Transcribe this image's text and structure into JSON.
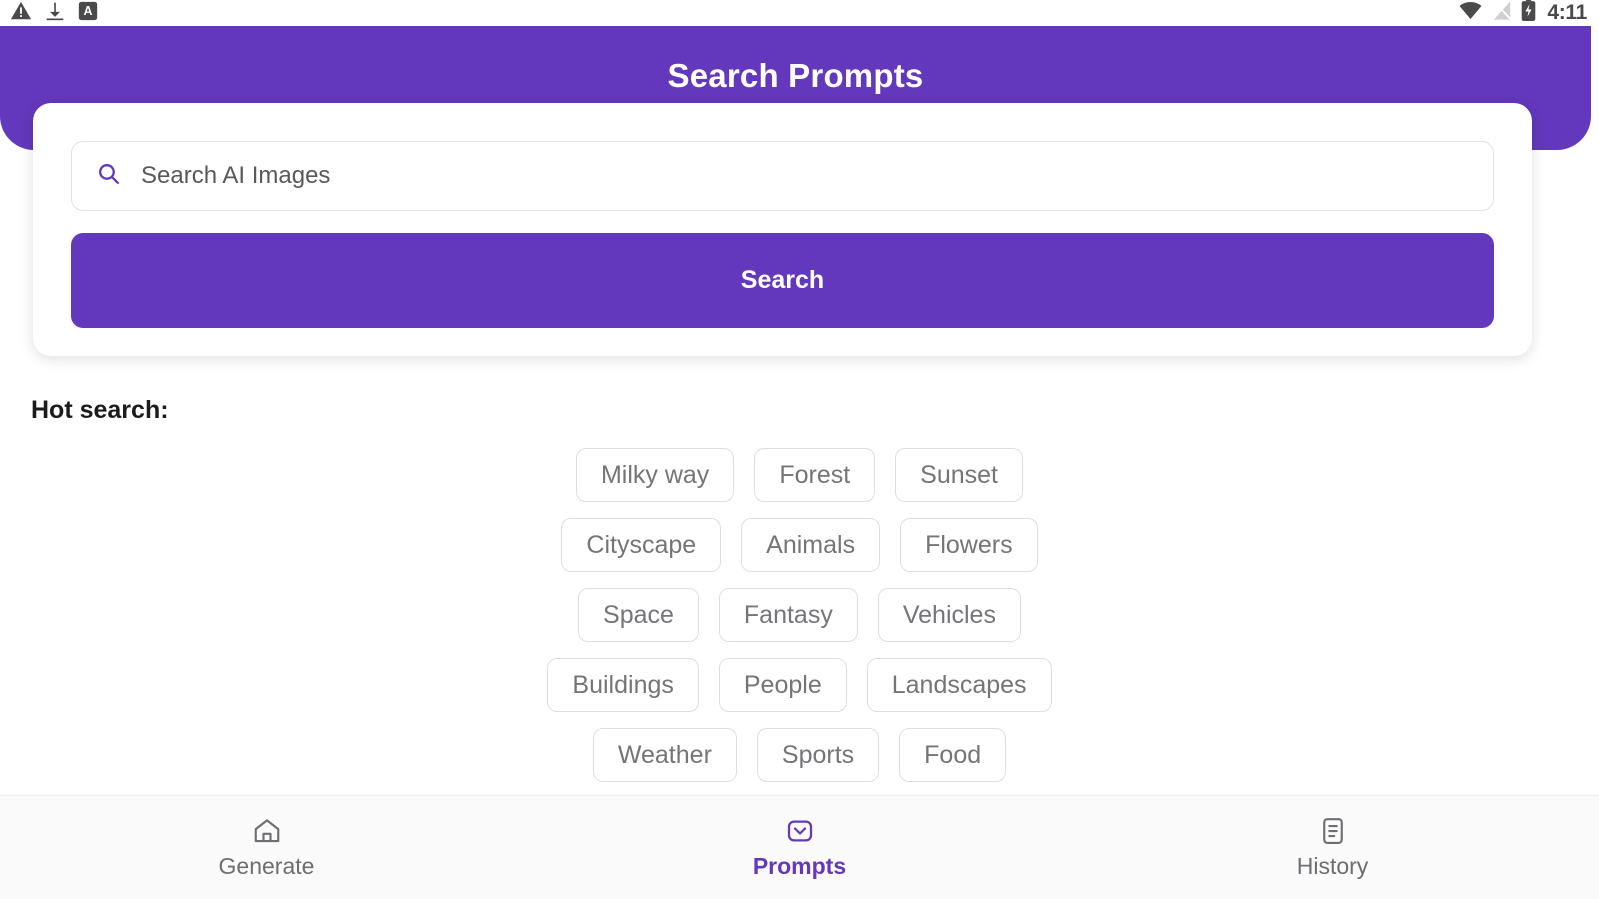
{
  "statusbar": {
    "time": "4:11",
    "left_icons": [
      "warning-triangle-icon",
      "download-icon",
      "screenshot-a-icon"
    ],
    "right_icons": [
      "wifi-icon",
      "no-sim-icon",
      "battery-charging-icon"
    ]
  },
  "header": {
    "title": "Search Prompts",
    "background_color": "#6338bc"
  },
  "search": {
    "placeholder": "Search AI Images",
    "value": "",
    "icon": "search-icon",
    "button_label": "Search",
    "button_color": "#6338bc"
  },
  "hot_search": {
    "label": "Hot search:",
    "rows": [
      [
        "Milky way",
        "Forest",
        "Sunset"
      ],
      [
        "Cityscape",
        "Animals",
        "Flowers"
      ],
      [
        "Space",
        "Fantasy",
        "Vehicles"
      ],
      [
        "Buildings",
        "People",
        "Landscapes"
      ],
      [
        "Weather",
        "Sports",
        "Food"
      ]
    ]
  },
  "bottom_nav": {
    "active_color": "#6338bc",
    "inactive_color": "#6d6d72",
    "items": [
      {
        "label": "Generate",
        "icon": "home-icon",
        "active": false
      },
      {
        "label": "Prompts",
        "icon": "message-icon",
        "active": true
      },
      {
        "label": "History",
        "icon": "document-list-icon",
        "active": false
      }
    ]
  }
}
